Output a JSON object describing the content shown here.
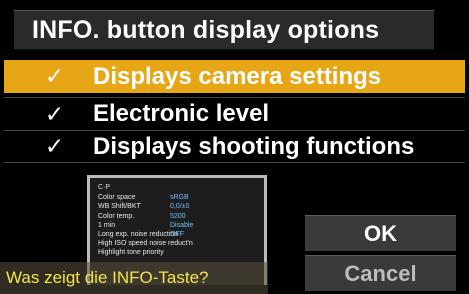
{
  "title": "INFO. button display options",
  "options": [
    {
      "check": "✓",
      "label": "Displays camera settings",
      "selected": true
    },
    {
      "check": "✓",
      "label": "Electronic level",
      "selected": false
    },
    {
      "check": "✓",
      "label": "Displays shooting functions",
      "selected": false
    }
  ],
  "preview": {
    "header": "C·P",
    "rows": [
      {
        "key": "Color space",
        "value": "sRGB"
      },
      {
        "key": "WB Shift/BKT",
        "value": "0,0/±0"
      },
      {
        "key": "Color temp.",
        "value": "5200"
      },
      {
        "key": "1 min",
        "value": "Disable"
      },
      {
        "key": "Long exp. noise reduction",
        "value": "OFF"
      },
      {
        "key": "High ISO speed noise reduct'n",
        "value": ""
      },
      {
        "key": "Highlight tone priority",
        "value": ""
      }
    ]
  },
  "buttons": {
    "ok": "OK",
    "cancel": "Cancel"
  },
  "caption": "Was zeigt die INFO-Taste?"
}
